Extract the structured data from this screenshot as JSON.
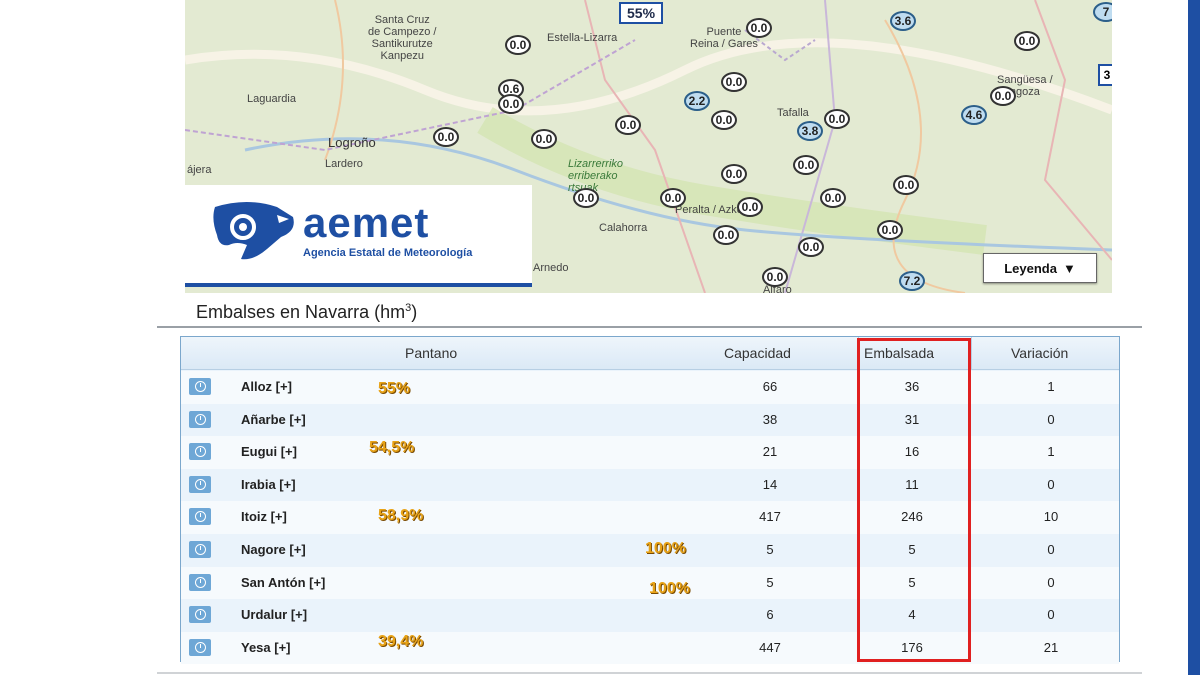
{
  "map": {
    "top_badge": "55%",
    "edge_badge": "3",
    "legend_label": "Leyenda",
    "places": [
      {
        "id": "santa-cruz",
        "text": "Santa Cruz\nde Campezo /\nSantikurutze\nKanpezu"
      },
      {
        "id": "estella",
        "text": "Estella-Lizarra"
      },
      {
        "id": "puente",
        "text": "Puente\nReina / Gares"
      },
      {
        "id": "sanguesa",
        "text": "Sangüesa /\nZangoza"
      },
      {
        "id": "laguardia",
        "text": "Laguardia"
      },
      {
        "id": "tafalla",
        "text": "Tafalla"
      },
      {
        "id": "logrono",
        "text": "Logroño"
      },
      {
        "id": "lardero",
        "text": "Lardero"
      },
      {
        "id": "najera",
        "text": "ájera"
      },
      {
        "id": "lizarrerriko",
        "text": "Lizarrerriko\nerriberako\nrtsuak"
      },
      {
        "id": "peralta",
        "text": "Peralta / Azkoien"
      },
      {
        "id": "calahorra",
        "text": "Calahorra"
      },
      {
        "id": "arnedo",
        "text": "Arnedo"
      },
      {
        "id": "alfaro",
        "text": "Alfaro"
      }
    ],
    "bubbles": [
      {
        "id": "b1",
        "v": "0.0",
        "blue": false
      },
      {
        "id": "b2",
        "v": "0.0",
        "blue": false
      },
      {
        "id": "b3",
        "v": "3.6",
        "blue": true
      },
      {
        "id": "b4",
        "v": "0.0",
        "blue": false
      },
      {
        "id": "b5",
        "v": "0.6",
        "blue": false
      },
      {
        "id": "b6",
        "v": "0.0",
        "blue": false
      },
      {
        "id": "b7",
        "v": "0.0",
        "blue": false
      },
      {
        "id": "b8",
        "v": "2.2",
        "blue": true
      },
      {
        "id": "b9",
        "v": "0.0",
        "blue": false
      },
      {
        "id": "b10",
        "v": "0.0",
        "blue": false
      },
      {
        "id": "b11",
        "v": "4.6",
        "blue": true
      },
      {
        "id": "b12",
        "v": "0.0",
        "blue": false
      },
      {
        "id": "b13",
        "v": "0.0",
        "blue": false
      },
      {
        "id": "b14",
        "v": "0.0",
        "blue": false
      },
      {
        "id": "b15",
        "v": "3.8",
        "blue": true
      },
      {
        "id": "b16",
        "v": "0.0",
        "blue": false
      },
      {
        "id": "b17",
        "v": "0.0",
        "blue": false
      },
      {
        "id": "b18",
        "v": "0.0",
        "blue": false
      },
      {
        "id": "b19",
        "v": "0.0",
        "blue": false
      },
      {
        "id": "b20",
        "v": "0.0",
        "blue": false
      },
      {
        "id": "b21",
        "v": "0.0",
        "blue": false
      },
      {
        "id": "b22",
        "v": "0.0",
        "blue": false
      },
      {
        "id": "b23",
        "v": "0.0",
        "blue": false
      },
      {
        "id": "b24",
        "v": "0.0",
        "blue": false
      },
      {
        "id": "b25",
        "v": "0.0",
        "blue": false
      },
      {
        "id": "b26",
        "v": "0.0",
        "blue": false
      },
      {
        "id": "b27",
        "v": "0.0",
        "blue": false
      },
      {
        "id": "b28",
        "v": "7.2",
        "blue": true
      },
      {
        "id": "b29",
        "v": "7",
        "blue": true
      }
    ]
  },
  "logo": {
    "word": "aemet",
    "subtitle": "Agencia Estatal de Meteorología"
  },
  "title": {
    "text": "Embalses en Navarra (hm",
    "sup": "3",
    ")": ")",
    "close": ")"
  },
  "table": {
    "headers": {
      "pantano": "Pantano",
      "capacidad": "Capacidad",
      "embalsada": "Embalsada",
      "variacion": "Variación"
    },
    "rows": [
      {
        "name": "Alloz [+]",
        "cap": "66",
        "emb": "36",
        "var": "1"
      },
      {
        "name": "Añarbe [+]",
        "cap": "38",
        "emb": "31",
        "var": "0"
      },
      {
        "name": "Eugui [+]",
        "cap": "21",
        "emb": "16",
        "var": "1"
      },
      {
        "name": "Irabia [+]",
        "cap": "14",
        "emb": "11",
        "var": "0"
      },
      {
        "name": "Itoiz [+]",
        "cap": "417",
        "emb": "246",
        "var": "10"
      },
      {
        "name": "Nagore [+]",
        "cap": "5",
        "emb": "5",
        "var": "0"
      },
      {
        "name": "San Antón [+]",
        "cap": "5",
        "emb": "5",
        "var": "0"
      },
      {
        "name": "Urdalur [+]",
        "cap": "6",
        "emb": "4",
        "var": "0"
      },
      {
        "name": "Yesa [+]",
        "cap": "447",
        "emb": "176",
        "var": "21"
      }
    ]
  },
  "annotations": [
    "55%",
    "54,5%",
    "58,9%",
    "100%",
    "100%",
    "39,4%"
  ],
  "colors": {
    "brand": "#1e4fa3",
    "highlight": "#e02020",
    "annotation": "#e8a317"
  }
}
